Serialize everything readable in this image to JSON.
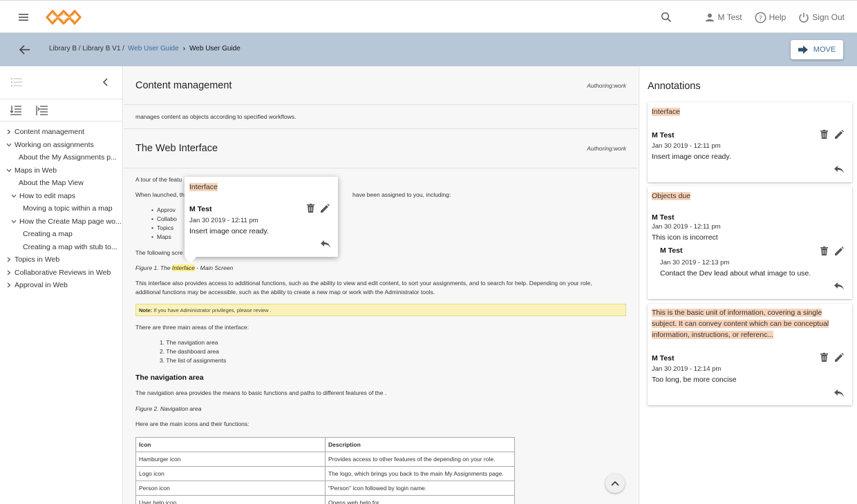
{
  "header": {
    "user": "M Test",
    "help": "Help",
    "signout": "Sign Out"
  },
  "breadcrumb": {
    "path": "Library B / Library B V1 /",
    "link": "Web User Guide",
    "current": "Web User Guide"
  },
  "move_label": "MOVE",
  "toc": [
    {
      "label": "Content management",
      "level": 0,
      "chevron": "right"
    },
    {
      "label": "Working on assignments",
      "level": 0,
      "chevron": "down"
    },
    {
      "label": "About the My Assignments p...",
      "level": 1,
      "chevron": ""
    },
    {
      "label": "Maps in Web",
      "level": 0,
      "chevron": "down"
    },
    {
      "label": "About the Map View",
      "level": 1,
      "chevron": ""
    },
    {
      "label": "How to edit maps",
      "level": 1,
      "chevron": "down"
    },
    {
      "label": "Moving a topic within a map",
      "level": 2,
      "chevron": ""
    },
    {
      "label": "How the Create Map page wo...",
      "level": 1,
      "chevron": "down"
    },
    {
      "label": "Creating a map",
      "level": 2,
      "chevron": ""
    },
    {
      "label": "Creating a map with stub to...",
      "level": 2,
      "chevron": ""
    },
    {
      "label": "Topics in Web",
      "level": 0,
      "chevron": "right"
    },
    {
      "label": "Collaborative Reviews in Web",
      "level": 0,
      "chevron": "right"
    },
    {
      "label": "Approval in Web",
      "level": 0,
      "chevron": "right"
    }
  ],
  "main": {
    "sec1_title": "Content management",
    "sec1_author": "Authoring:work",
    "sec1_text": "manages content as objects according to specified workflows.",
    "sec2_title": "The Web Interface",
    "sec2_author": "Authoring:work",
    "p_tour": "A tour of the featu",
    "p_launch_a": "When launched, th",
    "p_launch_b": "have been assigned to you, including:",
    "bullets": [
      "Approv",
      "Collabo",
      "Topics",
      "Maps"
    ],
    "p_following": "The following scre",
    "fig1_a": "Figure 1. The ",
    "fig1_hl": "Interface",
    "fig1_b": " - Main Screen",
    "p_access_1": "This interface also provides access to additional functions, such as the ability to view and edit content, to sort your assignments, and to search for help. Depending on your role,",
    "p_access_2": "additional functions may be accessible, such as the ability to create a new map or work with the Administrator tools.",
    "note_label": "Note:",
    "note_text": " If you have Administrator privileges, please review .",
    "p_three": "There are three main areas of the interface:",
    "areas": [
      "1. The navigation area",
      "2. The dashboard area",
      "3. The list of assignments"
    ],
    "nav_heading": "The navigation area",
    "p_nav": "The navigation area provides the means to basic functions and paths to different features of the .",
    "fig2": "Figure 2. Navigation area",
    "p_icons": "Here are the main icons and their functions:",
    "table": {
      "headers": [
        "Icon",
        "Description"
      ],
      "rows": [
        [
          "Hamburger icon",
          "Provides access to other features of the depending on your role."
        ],
        [
          "Logo icon",
          "The logo, which brings you back to the main My Assignments page."
        ],
        [
          "Person icon",
          "\"Person\" icon followed by login name."
        ],
        [
          "User help icon",
          "Opens web help for ."
        ]
      ]
    }
  },
  "popup": {
    "quote": "Interface",
    "author": "M Test",
    "date": "Jan 30 2019 - 12:11 pm",
    "text": "Insert image once ready."
  },
  "annotations": {
    "title": "Annotations",
    "cards": [
      {
        "quote": "Interface",
        "author": "M Test",
        "date": "Jan 30 2019 - 12:11 pm",
        "text": "Insert image once ready."
      },
      {
        "quote": "Objects due",
        "author": "M Test",
        "date": "Jan 30 2019 - 12:11 pm",
        "text": "This icon is incorrect",
        "reply": {
          "author": "M Test",
          "date": "Jan 30 2019 - 12:13 pm",
          "text": "Contact the Dev lead about what image to use."
        }
      },
      {
        "quote_lines": [
          "This is the basic unit of information, covering a single",
          "subject. It can convey content which can be conceptual",
          "information, instructions, or referenc..."
        ],
        "author": "M Test",
        "date": "Jan 30 2019 - 12:14 pm",
        "text": "Too long, be more concise"
      }
    ]
  },
  "colors": {
    "accent": "#3f6c9c",
    "crumbbar": "#b7c7d7",
    "logo": "#f08a24",
    "highlight": "#f7d3ba"
  }
}
